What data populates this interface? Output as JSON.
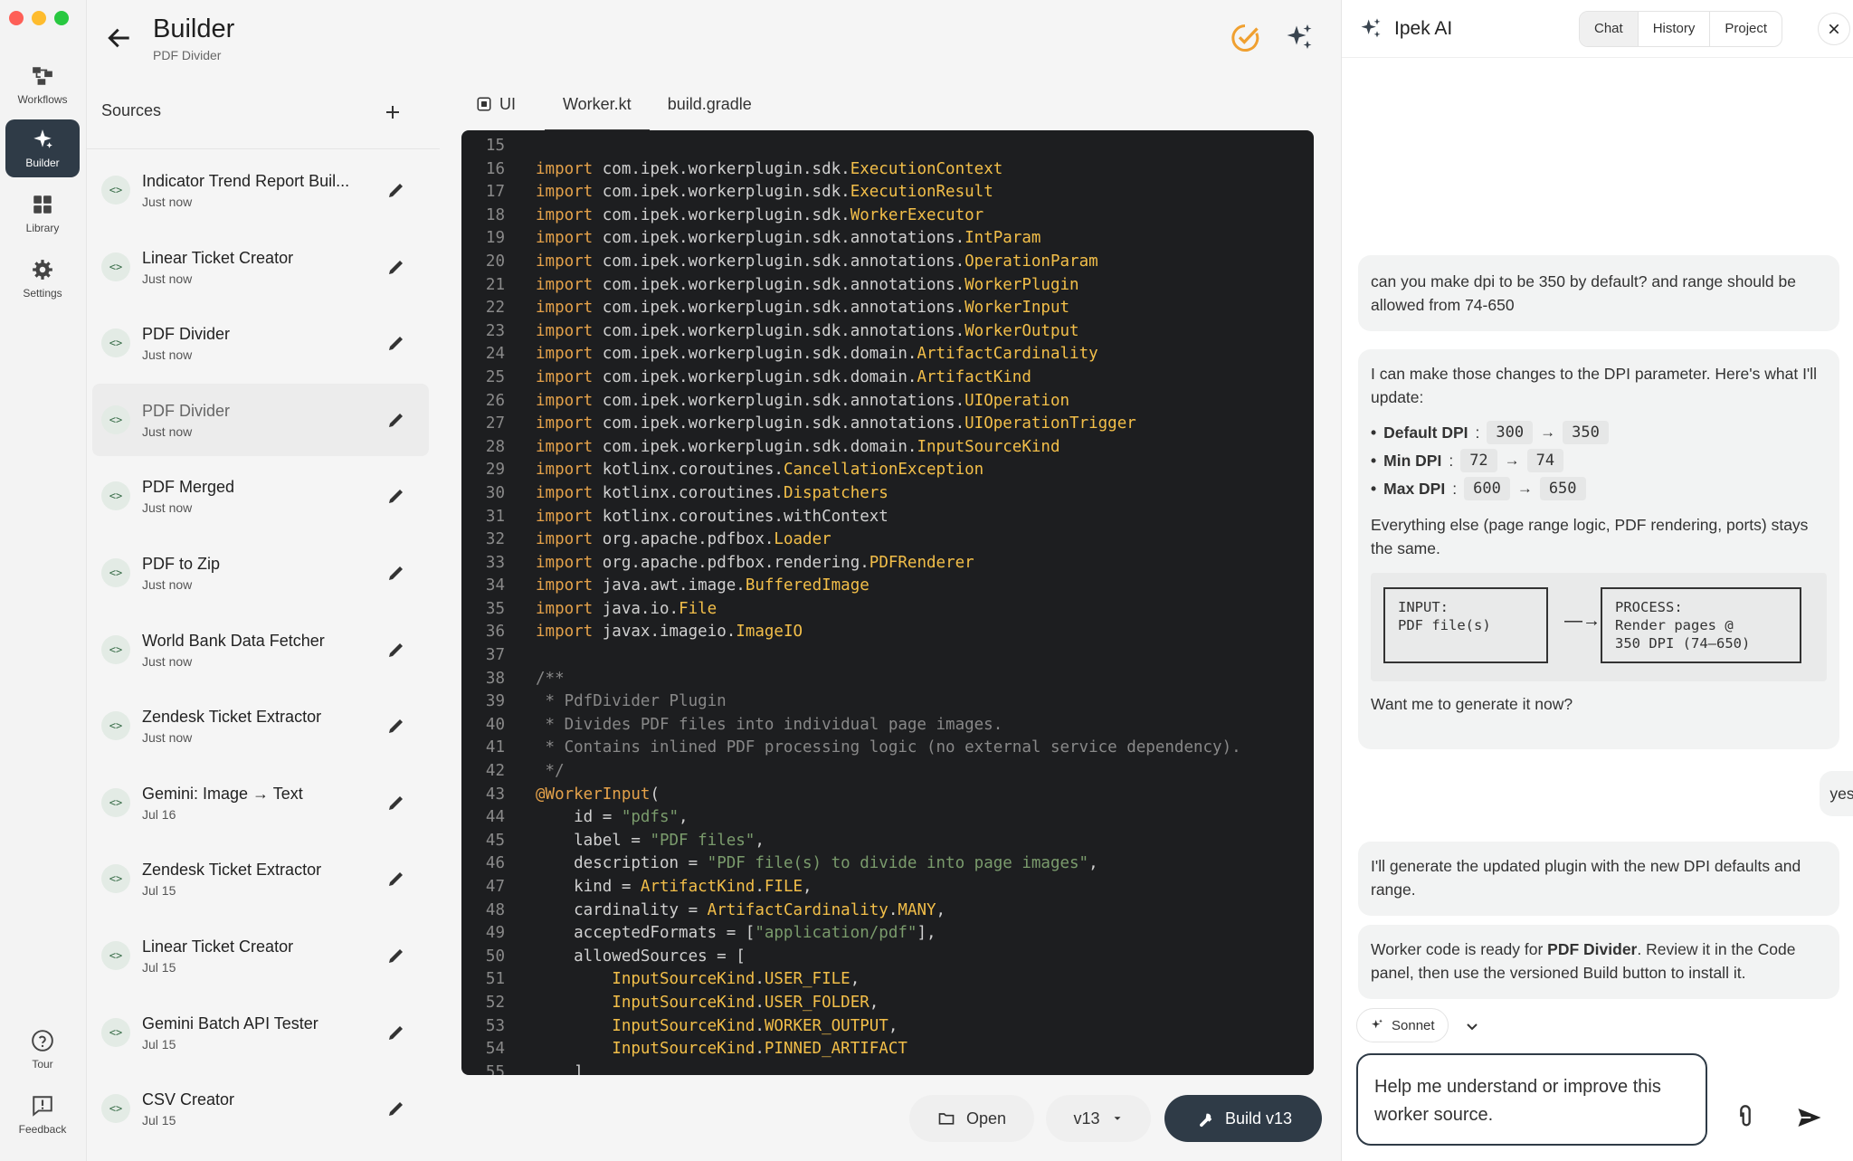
{
  "rail": {
    "items": [
      {
        "label": "Workflows",
        "icon": "workflows-icon"
      },
      {
        "label": "Builder",
        "icon": "sparkle-icon",
        "active": true
      },
      {
        "label": "Library",
        "icon": "grid-icon"
      },
      {
        "label": "Settings",
        "icon": "gear-icon"
      }
    ],
    "bottom": [
      {
        "label": "Tour",
        "icon": "help-icon"
      },
      {
        "label": "Feedback",
        "icon": "feedback-icon"
      }
    ]
  },
  "header": {
    "title": "Builder",
    "subtitle": "PDF Divider"
  },
  "sources": {
    "heading": "Sources",
    "items": [
      {
        "name": "Indicator Trend Report Buil...",
        "date": "Just now"
      },
      {
        "name": "Linear Ticket Creator",
        "date": "Just now"
      },
      {
        "name": "PDF Divider",
        "date": "Just now"
      },
      {
        "name": "PDF Divider",
        "date": "Just now",
        "selected": true
      },
      {
        "name": "PDF Merged",
        "date": "Just now"
      },
      {
        "name": "PDF to Zip",
        "date": "Just now"
      },
      {
        "name": "World Bank Data Fetcher",
        "date": "Just now"
      },
      {
        "name": "Zendesk Ticket Extractor",
        "date": "Just now"
      },
      {
        "name": "Gemini: Image → Text",
        "date": "Jul 16"
      },
      {
        "name": "Zendesk Ticket Extractor",
        "date": "Jul 15"
      },
      {
        "name": "Linear Ticket Creator",
        "date": "Jul 15"
      },
      {
        "name": "Gemini Batch API Tester",
        "date": "Jul 15"
      },
      {
        "name": "CSV Creator",
        "date": "Jul 15"
      }
    ]
  },
  "tabs": [
    {
      "label": "UI",
      "active": false
    },
    {
      "label": "Worker.kt",
      "active": true
    },
    {
      "label": "build.gradle",
      "active": false
    }
  ],
  "code": {
    "lines": [
      {
        "n": "15",
        "segs": []
      },
      {
        "n": "16",
        "segs": [
          [
            "kw",
            "import"
          ],
          [
            "",
            "com.ipek.workerplugin.sdk."
          ],
          [
            "cls",
            "ExecutionContext"
          ]
        ]
      },
      {
        "n": "17",
        "segs": [
          [
            "kw",
            "import"
          ],
          [
            "",
            "com.ipek.workerplugin.sdk."
          ],
          [
            "cls",
            "ExecutionResult"
          ]
        ]
      },
      {
        "n": "18",
        "segs": [
          [
            "kw",
            "import"
          ],
          [
            "",
            "com.ipek.workerplugin.sdk."
          ],
          [
            "cls",
            "WorkerExecutor"
          ]
        ]
      },
      {
        "n": "19",
        "segs": [
          [
            "kw",
            "import"
          ],
          [
            "",
            "com.ipek.workerplugin.sdk.annotations."
          ],
          [
            "cls",
            "IntParam"
          ]
        ]
      },
      {
        "n": "20",
        "segs": [
          [
            "kw",
            "import"
          ],
          [
            "",
            "com.ipek.workerplugin.sdk.annotations."
          ],
          [
            "cls",
            "OperationParam"
          ]
        ]
      },
      {
        "n": "21",
        "segs": [
          [
            "kw",
            "import"
          ],
          [
            "",
            "com.ipek.workerplugin.sdk.annotations."
          ],
          [
            "cls",
            "WorkerPlugin"
          ]
        ]
      },
      {
        "n": "22",
        "segs": [
          [
            "kw",
            "import"
          ],
          [
            "",
            "com.ipek.workerplugin.sdk.annotations."
          ],
          [
            "cls",
            "WorkerInput"
          ]
        ]
      },
      {
        "n": "23",
        "segs": [
          [
            "kw",
            "import"
          ],
          [
            "",
            "com.ipek.workerplugin.sdk.annotations."
          ],
          [
            "cls",
            "WorkerOutput"
          ]
        ]
      },
      {
        "n": "24",
        "segs": [
          [
            "kw",
            "import"
          ],
          [
            "",
            "com.ipek.workerplugin.sdk.domain."
          ],
          [
            "cls",
            "ArtifactCardinality"
          ]
        ]
      },
      {
        "n": "25",
        "segs": [
          [
            "kw",
            "import"
          ],
          [
            "",
            "com.ipek.workerplugin.sdk.domain."
          ],
          [
            "cls",
            "ArtifactKind"
          ]
        ]
      },
      {
        "n": "26",
        "segs": [
          [
            "kw",
            "import"
          ],
          [
            "",
            "com.ipek.workerplugin.sdk.annotations."
          ],
          [
            "cls",
            "UIOperation"
          ]
        ]
      },
      {
        "n": "27",
        "segs": [
          [
            "kw",
            "import"
          ],
          [
            "",
            "com.ipek.workerplugin.sdk.annotations."
          ],
          [
            "cls",
            "UIOperationTrigger"
          ]
        ]
      },
      {
        "n": "28",
        "segs": [
          [
            "kw",
            "import"
          ],
          [
            "",
            "com.ipek.workerplugin.sdk.domain."
          ],
          [
            "cls",
            "InputSourceKind"
          ]
        ]
      },
      {
        "n": "29",
        "segs": [
          [
            "kw",
            "import"
          ],
          [
            "",
            "kotlinx.coroutines."
          ],
          [
            "cls",
            "CancellationException"
          ]
        ]
      },
      {
        "n": "30",
        "segs": [
          [
            "kw",
            "import"
          ],
          [
            "",
            "kotlinx.coroutines."
          ],
          [
            "cls",
            "Dispatchers"
          ]
        ]
      },
      {
        "n": "31",
        "segs": [
          [
            "kw",
            "import"
          ],
          [
            "",
            "kotlinx.coroutines.withContext"
          ]
        ]
      },
      {
        "n": "32",
        "segs": [
          [
            "kw",
            "import"
          ],
          [
            "",
            "org.apache.pdfbox."
          ],
          [
            "cls",
            "Loader"
          ]
        ]
      },
      {
        "n": "33",
        "segs": [
          [
            "kw",
            "import"
          ],
          [
            "",
            "org.apache.pdfbox.rendering."
          ],
          [
            "cls",
            "PDFRenderer"
          ]
        ]
      },
      {
        "n": "34",
        "segs": [
          [
            "kw",
            "import"
          ],
          [
            "",
            "java.awt.image."
          ],
          [
            "cls",
            "BufferedImage"
          ]
        ]
      },
      {
        "n": "35",
        "segs": [
          [
            "kw",
            "import"
          ],
          [
            "",
            "java.io."
          ],
          [
            "cls",
            "File"
          ]
        ]
      },
      {
        "n": "36",
        "segs": [
          [
            "kw",
            "import"
          ],
          [
            "",
            "javax.imageio."
          ],
          [
            "cls",
            "ImageIO"
          ]
        ]
      },
      {
        "n": "37",
        "segs": []
      },
      {
        "n": "38",
        "segs": [
          [
            "cmt",
            "/**"
          ]
        ]
      },
      {
        "n": "39",
        "segs": [
          [
            "cmt",
            " * PdfDivider Plugin"
          ]
        ]
      },
      {
        "n": "40",
        "segs": [
          [
            "cmt",
            " * Divides PDF files into individual page images."
          ]
        ]
      },
      {
        "n": "41",
        "segs": [
          [
            "cmt",
            " * Contains inlined PDF processing logic (no external service dependency)."
          ]
        ]
      },
      {
        "n": "42",
        "segs": [
          [
            "cmt",
            " */"
          ]
        ]
      },
      {
        "n": "43",
        "segs": [
          [
            "ann",
            "@WorkerInput"
          ],
          [
            "",
            "("
          ]
        ]
      },
      {
        "n": "44",
        "segs": [
          [
            "",
            "    id = "
          ],
          [
            "str",
            "\"pdfs\""
          ],
          [
            "",
            ","
          ]
        ]
      },
      {
        "n": "45",
        "segs": [
          [
            "",
            "    label = "
          ],
          [
            "str",
            "\"PDF files\""
          ],
          [
            "",
            ","
          ]
        ]
      },
      {
        "n": "46",
        "segs": [
          [
            "",
            "    description = "
          ],
          [
            "str",
            "\"PDF file(s) to divide into page images\""
          ],
          [
            "",
            ","
          ]
        ]
      },
      {
        "n": "47",
        "segs": [
          [
            "",
            "    kind = "
          ],
          [
            "cls",
            "ArtifactKind"
          ],
          [
            "",
            "."
          ],
          [
            "cls",
            "FILE"
          ],
          [
            "",
            ","
          ]
        ]
      },
      {
        "n": "48",
        "segs": [
          [
            "",
            "    cardinality = "
          ],
          [
            "cls",
            "ArtifactCardinality"
          ],
          [
            "",
            "."
          ],
          [
            "cls",
            "MANY"
          ],
          [
            "",
            ","
          ]
        ]
      },
      {
        "n": "49",
        "segs": [
          [
            "",
            "    acceptedFormats = ["
          ],
          [
            "str",
            "\"application/pdf\""
          ],
          [
            "",
            "],"
          ]
        ]
      },
      {
        "n": "50",
        "segs": [
          [
            "",
            "    allowedSources = ["
          ]
        ]
      },
      {
        "n": "51",
        "segs": [
          [
            "cls",
            "        InputSourceKind"
          ],
          [
            "",
            "."
          ],
          [
            "cls",
            "USER_FILE"
          ],
          [
            "",
            ","
          ]
        ]
      },
      {
        "n": "52",
        "segs": [
          [
            "cls",
            "        InputSourceKind"
          ],
          [
            "",
            "."
          ],
          [
            "cls",
            "USER_FOLDER"
          ],
          [
            "",
            ","
          ]
        ]
      },
      {
        "n": "53",
        "segs": [
          [
            "cls",
            "        InputSourceKind"
          ],
          [
            "",
            "."
          ],
          [
            "cls",
            "WORKER_OUTPUT"
          ],
          [
            "",
            ","
          ]
        ]
      },
      {
        "n": "54",
        "segs": [
          [
            "cls",
            "        InputSourceKind"
          ],
          [
            "",
            "."
          ],
          [
            "cls",
            "PINNED_ARTIFACT"
          ]
        ]
      },
      {
        "n": "55",
        "segs": [
          [
            "",
            "    ]"
          ]
        ]
      }
    ]
  },
  "bottom": {
    "open_label": "Open",
    "version_label": "v13",
    "build_label": "Build v13"
  },
  "ai": {
    "title": "Ipek AI",
    "tabs": [
      "Chat",
      "History",
      "Project"
    ],
    "active_tab": "Chat",
    "msg_user1": "can you make dpi to be 350 by default? and range should be allowed from 74-650",
    "msg_ai1_intro": "I can make those changes to the DPI parameter. Here's what I'll update:",
    "dpi_changes": [
      {
        "label": "Default DPI",
        "from": "300",
        "to": "350"
      },
      {
        "label": "Min DPI",
        "from": "72",
        "to": "74"
      },
      {
        "label": "Max DPI",
        "from": "600",
        "to": "650"
      }
    ],
    "msg_ai1_note": "Everything else (page range logic, PDF rendering, ports) stays the same.",
    "diagram": {
      "input_box": "INPUT:\nPDF file(s)",
      "process_box": "PROCESS:\nRender pages @\n350 DPI (74–650)",
      "arrow": "—→"
    },
    "msg_ai1_question": "Want me to generate it now?",
    "msg_user2": "yes",
    "msg_ai2": "I'll generate the updated plugin with the new DPI defaults and range.",
    "msg_ai3_pre": "Worker code is ready for ",
    "msg_ai3_bold": "PDF Divider",
    "msg_ai3_post": ". Review it in the Code panel, then use the versioned Build button to install it.",
    "model_label": "Sonnet",
    "composer_text": "Help me understand or improve this worker source."
  },
  "colors": {
    "accent_dark": "#2f3b47",
    "code_bg": "#1d1e20",
    "code_keyword": "#e5a24a",
    "code_class": "#f3bf49",
    "code_string": "#7a9b6c",
    "status_check": "#f0a030"
  }
}
